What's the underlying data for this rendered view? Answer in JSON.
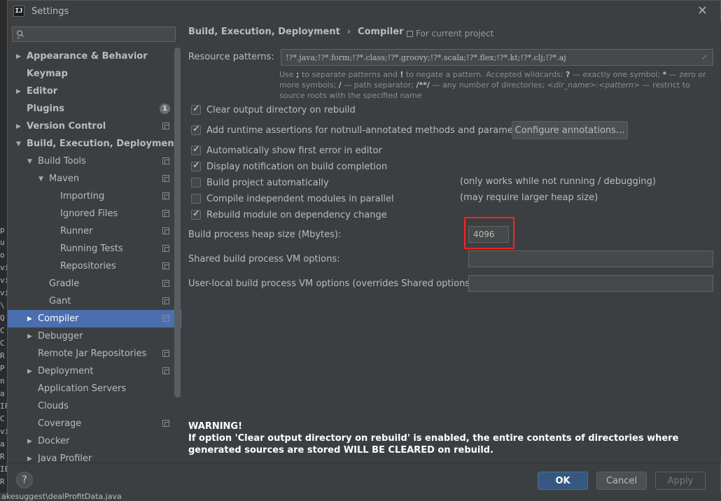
{
  "window": {
    "title": "Settings"
  },
  "search": {
    "placeholder": ""
  },
  "tree": [
    {
      "label": "Appearance & Behavior",
      "bold": true,
      "arrow": "right",
      "indent": 0
    },
    {
      "label": "Keymap",
      "bold": true,
      "arrow": "",
      "indent": 0
    },
    {
      "label": "Editor",
      "bold": true,
      "arrow": "right",
      "indent": 0
    },
    {
      "label": "Plugins",
      "bold": true,
      "arrow": "",
      "indent": 0,
      "badge": "1"
    },
    {
      "label": "Version Control",
      "bold": true,
      "arrow": "right",
      "indent": 0,
      "copy": true
    },
    {
      "label": "Build, Execution, Deployment",
      "bold": true,
      "arrow": "down",
      "indent": 0
    },
    {
      "label": "Build Tools",
      "bold": false,
      "arrow": "down",
      "indent": 1,
      "copy": true
    },
    {
      "label": "Maven",
      "bold": false,
      "arrow": "down",
      "indent": 2,
      "copy": true
    },
    {
      "label": "Importing",
      "bold": false,
      "arrow": "",
      "indent": 3,
      "copy": true
    },
    {
      "label": "Ignored Files",
      "bold": false,
      "arrow": "",
      "indent": 3,
      "copy": true
    },
    {
      "label": "Runner",
      "bold": false,
      "arrow": "",
      "indent": 3,
      "copy": true
    },
    {
      "label": "Running Tests",
      "bold": false,
      "arrow": "",
      "indent": 3,
      "copy": true
    },
    {
      "label": "Repositories",
      "bold": false,
      "arrow": "",
      "indent": 3,
      "copy": true
    },
    {
      "label": "Gradle",
      "bold": false,
      "arrow": "",
      "indent": 2,
      "copy": true
    },
    {
      "label": "Gant",
      "bold": false,
      "arrow": "",
      "indent": 2,
      "copy": true
    },
    {
      "label": "Compiler",
      "bold": false,
      "arrow": "right",
      "indent": 1,
      "copy": true,
      "selected": true
    },
    {
      "label": "Debugger",
      "bold": false,
      "arrow": "right",
      "indent": 1
    },
    {
      "label": "Remote Jar Repositories",
      "bold": false,
      "arrow": "",
      "indent": 1,
      "copy": true
    },
    {
      "label": "Deployment",
      "bold": false,
      "arrow": "right",
      "indent": 1,
      "copy": true
    },
    {
      "label": "Application Servers",
      "bold": false,
      "arrow": "",
      "indent": 1
    },
    {
      "label": "Clouds",
      "bold": false,
      "arrow": "",
      "indent": 1
    },
    {
      "label": "Coverage",
      "bold": false,
      "arrow": "",
      "indent": 1,
      "copy": true
    },
    {
      "label": "Docker",
      "bold": false,
      "arrow": "right",
      "indent": 1
    },
    {
      "label": "Java Profiler",
      "bold": false,
      "arrow": "right",
      "indent": 1
    }
  ],
  "breadcrumb": {
    "parent": "Build, Execution, Deployment",
    "separator": "›",
    "current": "Compiler"
  },
  "scope_note": "For current project",
  "resource_patterns": {
    "label": "Resource patterns:",
    "value": "!?*.java;!?*.form;!?*.class;!?*.groovy;!?*.scala;!?*.flex;!?*.kt;!?*.clj;!?*.aj"
  },
  "hint": {
    "p1": "Use ",
    "semi": ";",
    "p2": " to separate patterns and ",
    "bang": "!",
    "p3": " to negate a pattern. Accepted wildcards: ",
    "q": "?",
    "p4": " — exactly one symbol; ",
    "star": "*",
    "p5": " — zero or more symbols; ",
    "slash": "/",
    "p6": " — path separator; ",
    "dstar": "/**/",
    "p7": " — any number of directories; ",
    "dirname": "<dir_name>",
    "colon": ":",
    "pattern": "<pattern>",
    "p8": " — restrict to source roots with the specified name"
  },
  "checkboxes": [
    {
      "label": "Clear output directory on rebuild",
      "checked": true,
      "note": ""
    },
    {
      "label": "Add runtime assertions for notnull-annotated methods and parameters",
      "checked": true,
      "note": ""
    },
    {
      "label": "Automatically show first error in editor",
      "checked": true,
      "note": ""
    },
    {
      "label": "Display notification on build completion",
      "checked": true,
      "note": ""
    },
    {
      "label": "Build project automatically",
      "checked": false,
      "note": "(only works while not running / debugging)"
    },
    {
      "label": "Compile independent modules in parallel",
      "checked": false,
      "note": "(may require larger heap size)"
    },
    {
      "label": "Rebuild module on dependency change",
      "checked": true,
      "note": ""
    }
  ],
  "configure_annotations": "Configure annotations...",
  "heap": {
    "label": "Build process heap size (Mbytes):",
    "value": "4096"
  },
  "shared_vm": {
    "label": "Shared build process VM options:",
    "value": ""
  },
  "user_vm": {
    "label": "User-local build process VM options (overrides Shared options):",
    "value": ""
  },
  "warning": {
    "title": "WARNING!",
    "text": "If option 'Clear output directory on rebuild' is enabled, the entire contents of directories where generated sources are stored WILL BE CLEARED on rebuild."
  },
  "buttons": {
    "ok": "OK",
    "cancel": "Cancel",
    "apply": "Apply",
    "help": "?"
  },
  "background": {
    "status_text": "akesuggest\\dealProfitData.java",
    "edge_chars": [
      "p",
      "u",
      "o",
      "vi",
      "vi",
      "vi",
      "\\",
      "Q",
      "C",
      "C",
      "R",
      "P",
      "n",
      "a",
      "IF",
      "C",
      "vi",
      "a",
      "R",
      "IE",
      "R"
    ]
  },
  "colors": {
    "accent": "#4b6eaf",
    "primary_button": "#365880",
    "highlight": "#ff2020"
  }
}
